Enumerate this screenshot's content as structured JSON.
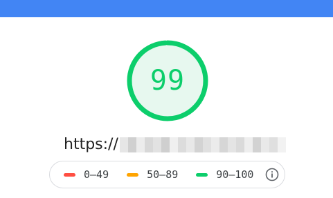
{
  "score": {
    "value": "99",
    "fraction": 0.99,
    "color": "#0cce6b",
    "fill_color": "#e7f8ef"
  },
  "header": {
    "bar_color": "#4285f4"
  },
  "url": {
    "visible_prefix": "https://",
    "redacted": true
  },
  "legend": {
    "items": [
      {
        "label": "0–49",
        "color": "#ff4e42",
        "icon": "fail-dash-icon"
      },
      {
        "label": "50–89",
        "color": "#ffa400",
        "icon": "average-dash-icon"
      },
      {
        "label": "90–100",
        "color": "#0cce6b",
        "icon": "pass-dash-icon"
      }
    ],
    "info_icon": "info-icon"
  }
}
